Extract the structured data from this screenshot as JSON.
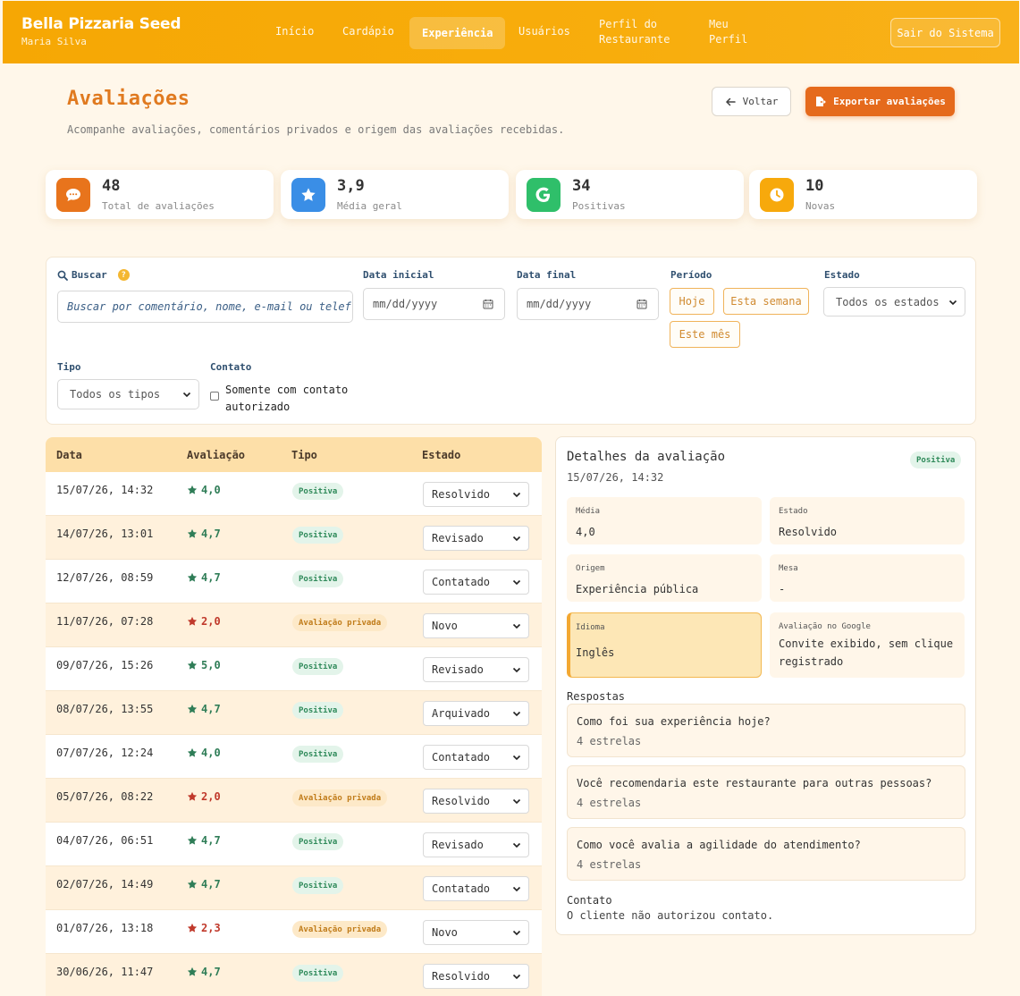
{
  "header": {
    "brand": "Bella Pizzaria Seed",
    "user": "Maria Silva",
    "nav": [
      {
        "label": "Início"
      },
      {
        "label": "Cardápio"
      },
      {
        "label": "Experiência"
      },
      {
        "label": "Usuários"
      },
      {
        "label1": "Perfil do",
        "label2": "Restaurante"
      },
      {
        "label1": "Meu",
        "label2": "Perfil"
      }
    ],
    "logout": "Sair do Sistema"
  },
  "page": {
    "title": "Avaliações",
    "subtitle": "Acompanhe avaliações, comentários privados e origem das avaliações recebidas.",
    "back": "Voltar",
    "export": "Exportar avaliações"
  },
  "stats": [
    {
      "value": "48",
      "label": "Total de avaliações",
      "color": "#e8741c"
    },
    {
      "value": "3,9",
      "label": "Média geral",
      "color": "#3a8ee6"
    },
    {
      "value": "34",
      "label": "Positivas",
      "color": "#2fbf6a"
    },
    {
      "value": "10",
      "label": "Novas",
      "color": "#f7a90c"
    }
  ],
  "filters": {
    "search_label": "Buscar",
    "search_placeholder": "Buscar por comentário, nome, e-mail ou telef",
    "start_label": "Data inicial",
    "end_label": "Data final",
    "date_placeholder": "mm/dd/yyyy",
    "period_label": "Período",
    "period_today": "Hoje",
    "period_week": "Esta semana",
    "period_month": "Este mês",
    "state_label": "Estado",
    "state_value": "Todos os estados",
    "type_label": "Tipo",
    "type_value": "Todos os tipos",
    "contact_label": "Contato",
    "contact_check1": "Somente com contato",
    "contact_check2": "autorizado"
  },
  "table": {
    "headers": {
      "date": "Data",
      "rating": "Avaliação",
      "type": "Tipo",
      "state": "Estado"
    },
    "rows": [
      {
        "date": "15/07/26, 14:32",
        "rating": "4,0",
        "type": "Positiva",
        "state": "Resolvido"
      },
      {
        "date": "14/07/26, 13:01",
        "rating": "4,7",
        "type": "Positiva",
        "state": "Revisado"
      },
      {
        "date": "12/07/26, 08:59",
        "rating": "4,7",
        "type": "Positiva",
        "state": "Contatado"
      },
      {
        "date": "11/07/26, 07:28",
        "rating": "2,0",
        "type": "Avaliação privada",
        "state": "Novo"
      },
      {
        "date": "09/07/26, 15:26",
        "rating": "5,0",
        "type": "Positiva",
        "state": "Revisado"
      },
      {
        "date": "08/07/26, 13:55",
        "rating": "4,7",
        "type": "Positiva",
        "state": "Arquivado"
      },
      {
        "date": "07/07/26, 12:24",
        "rating": "4,0",
        "type": "Positiva",
        "state": "Contatado"
      },
      {
        "date": "05/07/26, 08:22",
        "rating": "2,0",
        "type": "Avaliação privada",
        "state": "Resolvido"
      },
      {
        "date": "04/07/26, 06:51",
        "rating": "4,7",
        "type": "Positiva",
        "state": "Revisado"
      },
      {
        "date": "02/07/26, 14:49",
        "rating": "4,7",
        "type": "Positiva",
        "state": "Contatado"
      },
      {
        "date": "01/07/26, 13:18",
        "rating": "2,3",
        "type": "Avaliação privada",
        "state": "Novo"
      },
      {
        "date": "30/06/26, 11:47",
        "rating": "4,7",
        "type": "Positiva",
        "state": "Resolvido"
      }
    ]
  },
  "details": {
    "title": "Detalhes da avaliação",
    "date": "15/07/26, 14:32",
    "badge": "Positiva",
    "media_k": "Média",
    "media_v": "4,0",
    "estado_k": "Estado",
    "estado_v": "Resolvido",
    "origem_k": "Origem",
    "origem_v": "Experiência pública",
    "mesa_k": "Mesa",
    "mesa_v": "-",
    "idioma_k": "Idioma",
    "idioma_v": "Inglês",
    "google_k": "Avaliação no Google",
    "google_v1": "Convite exibido, sem clique",
    "google_v2": "registrado",
    "answers_label": "Respostas",
    "answers": [
      {
        "q": "Como foi sua experiência hoje?",
        "a": "4 estrelas"
      },
      {
        "q": "Você recomendaria este restaurante para outras pessoas?",
        "a": "4 estrelas"
      },
      {
        "q": "Como você avalia a agilidade do atendimento?",
        "a": "4 estrelas"
      }
    ],
    "contact_label": "Contato",
    "contact_value": "O cliente não autorizou contato."
  },
  "colors": {
    "accent": "#e56a1c",
    "positive": "#2f7d57",
    "negative": "#c0392b"
  }
}
